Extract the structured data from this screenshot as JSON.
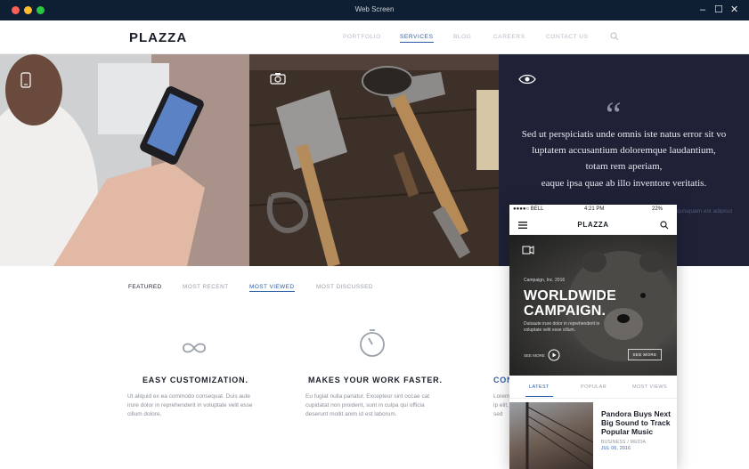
{
  "window": {
    "title": "Web Screen",
    "controls": [
      "–",
      "☐",
      "✕"
    ]
  },
  "nav": {
    "logo": "PLAZZA",
    "items": [
      "PORTFOLIO",
      "SERVICES",
      "BLOG",
      "CAREERS",
      "CONTACT US"
    ],
    "active": "SERVICES"
  },
  "hero": {
    "quote_mark": "“",
    "quote_lines": [
      "Sed ut perspiciatis unde omnis iste natus error sit vo",
      "luptatem accusantium doloremque laudantium,",
      "totam rem aperiam,",
      "eaque ipsa quae ab illo inventore veritatis."
    ],
    "quote_faded": "quisquam est adipisci"
  },
  "tabs": [
    "FEATURED",
    "MOST RECENT",
    "MOST VIEWED",
    "MOST DISCUSSED"
  ],
  "features": [
    {
      "title": "EASY CUSTOMIZATION.",
      "text": "Ut aliquid ex ea commodo consequat. Duis aute irure dolor in reprehenderit in voluptate velit esse cillum dolore."
    },
    {
      "title": "MAKES YOUR WORK FASTER.",
      "text": "Eu fugiat nulla pariatur. Excepteur sint occae cat cupidatat non proident, sunt in culpa qui officia deserunt mollit anim id est laborum."
    },
    {
      "title": "CON",
      "text": "Lorem ip elit, sed"
    }
  ],
  "phone": {
    "status": {
      "carrier": "●●●●○ BELL",
      "time": "4:21 PM",
      "battery": "22%"
    },
    "logo": "PLAZZA",
    "hero_small": "Campaign, Inc. 2016",
    "hero_title": [
      "WORLDWIDE",
      "CAMPAIGN."
    ],
    "hero_sub": [
      "Duisaute irure dolor in reprehenderit in",
      "voluptate velit esse cillum."
    ],
    "play_label": "SEE MORE",
    "button_label": "SEE MORE",
    "tabs": [
      "LATEST",
      "POPULAR",
      "MOST VIEWS"
    ],
    "article_title": [
      "Pandora Buys Next",
      "Big Sound to Track",
      "Popular Music"
    ],
    "article_meta": [
      "BUSINESS / MEDIA",
      "JUL 06, 2016"
    ]
  }
}
